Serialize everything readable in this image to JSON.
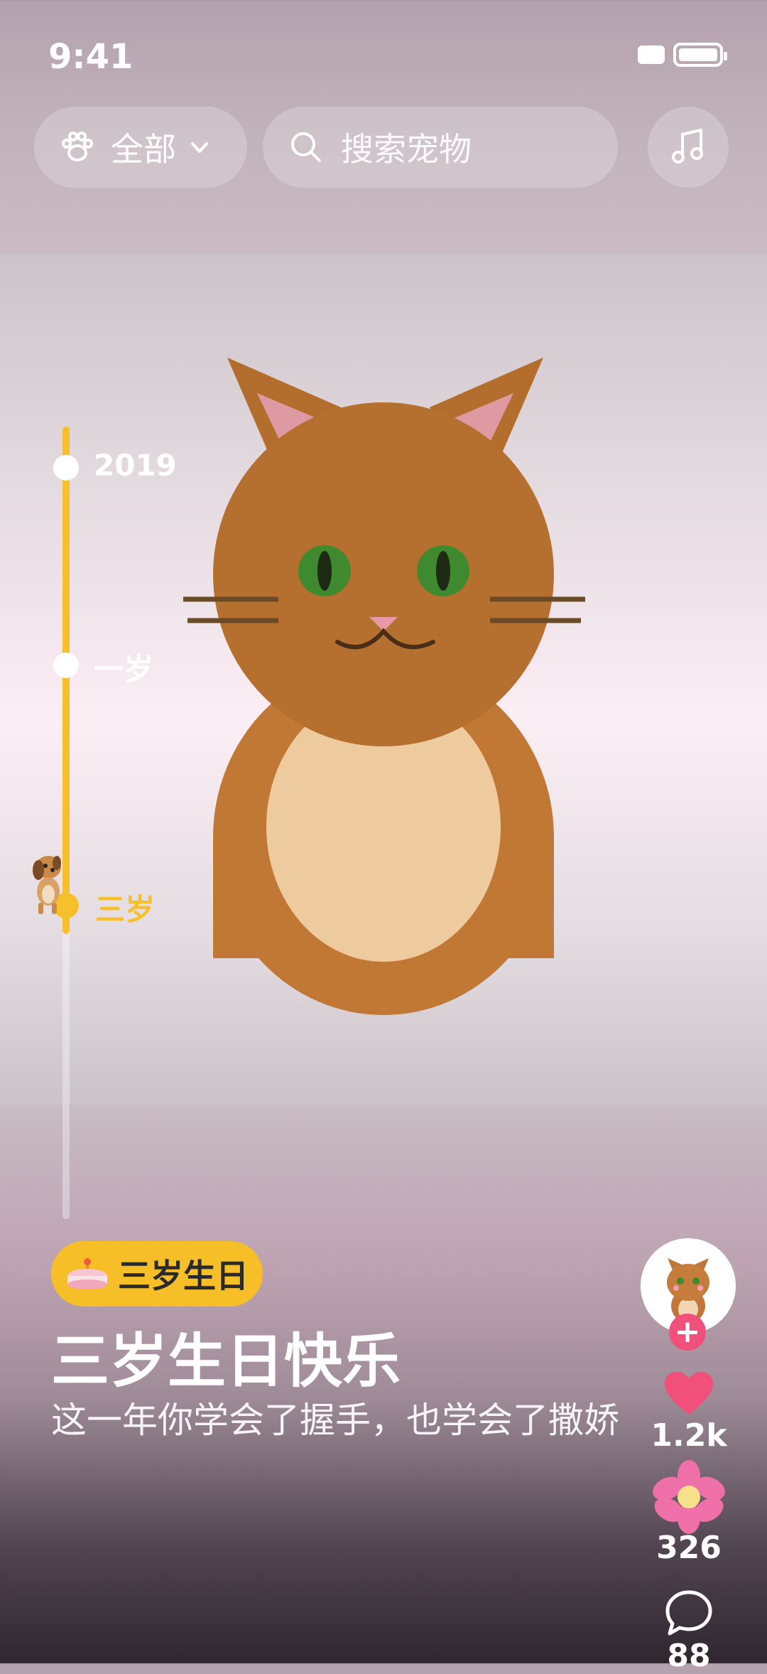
{
  "status_bar": {
    "time": "9:41"
  },
  "top_bar": {
    "filter_label": "全部",
    "search_placeholder": "搜索宠物"
  },
  "timeline": {
    "items": [
      {
        "label": "2019",
        "active": false
      },
      {
        "label": "一岁",
        "active": false
      },
      {
        "label": "三岁",
        "active": true
      }
    ],
    "progress_fraction": 0.64
  },
  "post": {
    "tag": "三岁生日",
    "title": "三岁生日快乐",
    "subtitle": "这一年你学会了握手，也学会了撒娇"
  },
  "actions": {
    "likes": "1.2k",
    "flowers": "326",
    "comments": "88"
  },
  "colors": {
    "accent": "#f7bf2a",
    "like": "#f0507a",
    "flower": "#ef6fa8"
  }
}
